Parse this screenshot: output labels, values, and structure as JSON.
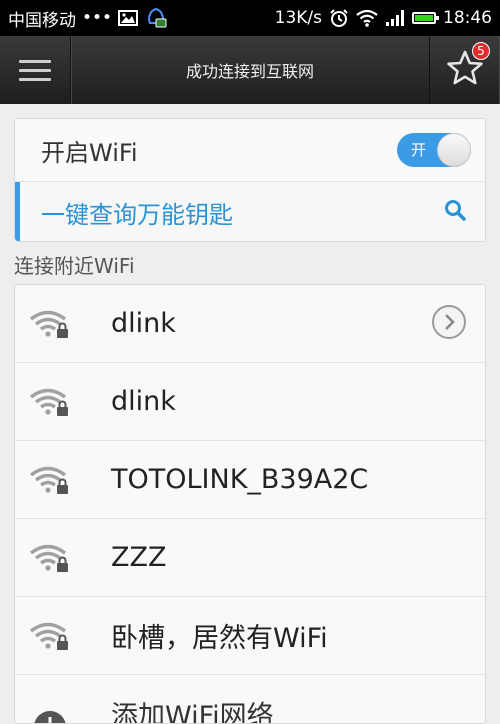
{
  "status_bar": {
    "carrier": "中国移动",
    "dots": "•••",
    "speed": "13K/s",
    "time": "18:46",
    "battery_color": "#35d41c"
  },
  "title_bar": {
    "title": "成功连接到互联网",
    "badge_count": "5"
  },
  "wifi_toggle": {
    "label": "开启WiFi",
    "state_label": "开",
    "accent": "#3b9be4"
  },
  "query": {
    "label": "一键查询万能钥匙",
    "color": "#2a93d5"
  },
  "section": {
    "nearby_label": "连接附近WiFi"
  },
  "networks": [
    {
      "ssid": "dlink",
      "has_detail": true
    },
    {
      "ssid": "dlink",
      "has_detail": false
    },
    {
      "ssid": "TOTOLINK_B39A2C",
      "has_detail": false
    },
    {
      "ssid": "ZZZ",
      "has_detail": false
    },
    {
      "ssid": "卧槽，居然有WiFi",
      "has_detail": false
    }
  ],
  "add_network": {
    "label": "添加WiFi网络"
  },
  "icons": {
    "menu": "menu-icon",
    "star": "star-icon",
    "search": "search-icon",
    "wifi_locked": "wifi-lock-icon",
    "chevron": "chevron-right-icon"
  }
}
